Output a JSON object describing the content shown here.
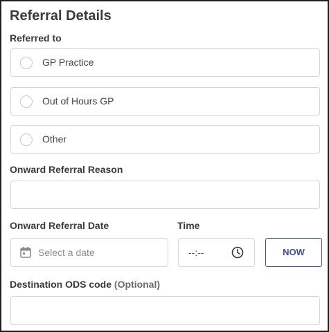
{
  "header": {
    "title": "Referral Details"
  },
  "referred_to": {
    "label": "Referred to",
    "options": [
      {
        "label": "GP Practice",
        "selected": false
      },
      {
        "label": "Out of Hours GP",
        "selected": false
      },
      {
        "label": "Other",
        "selected": false
      }
    ]
  },
  "onward_reason": {
    "label": "Onward Referral Reason",
    "value": ""
  },
  "onward_date": {
    "label": "Onward Referral Date",
    "placeholder": "Select a date",
    "icon": "calendar-icon"
  },
  "time": {
    "label": "Time",
    "placeholder": "--:--",
    "icon": "clock-icon",
    "now_label": "NOW"
  },
  "destination": {
    "label": "Destination ODS code",
    "optional_label": "(Optional)",
    "value": ""
  },
  "colors": {
    "accent": "#3d4aa8",
    "border": "#d6d6d6",
    "text": "#3a3a3a"
  }
}
